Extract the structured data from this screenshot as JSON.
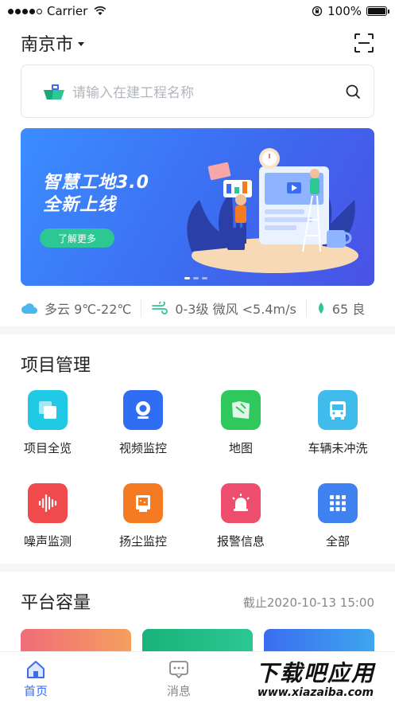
{
  "status": {
    "carrier": "Carrier",
    "battery": "100%"
  },
  "header": {
    "city": "南京市"
  },
  "search": {
    "placeholder": "请输入在建工程名称"
  },
  "banner": {
    "title_line1": "智慧工地3.0",
    "title_line2": "全新上线",
    "button": "了解更多",
    "page_count": 3,
    "active_page": 1
  },
  "weather": {
    "condition": "多云 9℃-22℃",
    "wind": "0-3级 微风 <5.4m/s",
    "aqi": "65 良"
  },
  "project": {
    "title": "项目管理",
    "items": [
      {
        "label": "项目全览",
        "icon": "project-overview-icon",
        "color": "#20c9e6"
      },
      {
        "label": "视频监控",
        "icon": "camera-icon",
        "color": "#2f6ef2"
      },
      {
        "label": "地图",
        "icon": "map-icon",
        "color": "#2fc85c"
      },
      {
        "label": "车辆未冲洗",
        "icon": "bus-icon",
        "color": "#3fbcec"
      },
      {
        "label": "噪声监测",
        "icon": "sound-wave-icon",
        "color": "#f04a4c"
      },
      {
        "label": "扬尘监控",
        "icon": "dust-monitor-icon",
        "color": "#f47b22"
      },
      {
        "label": "报警信息",
        "icon": "alarm-light-icon",
        "color": "#ee4e6e"
      },
      {
        "label": "全部",
        "icon": "grid-all-icon",
        "color": "#3f82ef"
      }
    ]
  },
  "platform": {
    "title": "平台容量",
    "deadline": "截止2020-10-13 15:00"
  },
  "tabs": [
    {
      "label": "首页",
      "icon": "home-icon"
    },
    {
      "label": "消息",
      "icon": "message-icon"
    }
  ],
  "watermark": {
    "line1": "下载吧应用",
    "line2": "www.xiazaiba.com"
  },
  "colors": {
    "accent": "#3a6df0",
    "green": "#2cc793"
  }
}
